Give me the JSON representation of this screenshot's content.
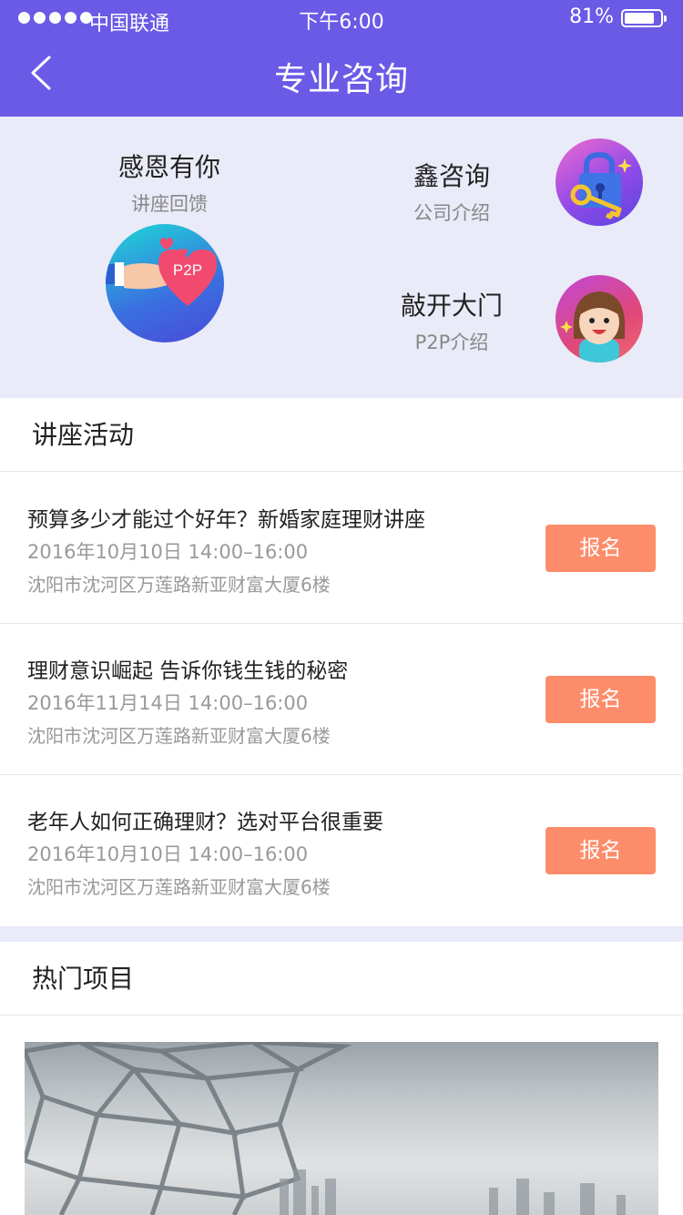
{
  "status_bar": {
    "carrier": "中国联通",
    "time": "下午6:00",
    "battery": "81%"
  },
  "nav": {
    "title": "专业咨询"
  },
  "tiles": {
    "left": {
      "title": "感恩有你",
      "subtitle": "讲座回馈",
      "badge": "P2P"
    },
    "right_top": {
      "title": "鑫咨询",
      "subtitle": "公司介绍"
    },
    "right_bottom": {
      "title": "敲开大门",
      "subtitle": "P2P介绍"
    }
  },
  "lectures": {
    "header": "讲座活动",
    "items": [
      {
        "title": "预算多少才能过个好年？新婚家庭理财讲座",
        "date": "2016年10月10日 14:00–16:00",
        "address": "沈阳市沈河区万莲路新亚财富大厦6楼",
        "button": "报名"
      },
      {
        "title": "理财意识崛起 告诉你钱生钱的秘密",
        "date": "2016年11月14日 14:00–16:00",
        "address": "沈阳市沈河区万莲路新亚财富大厦6楼",
        "button": "报名"
      },
      {
        "title": "老年人如何正确理财？选对平台很重要",
        "date": "2016年10月10日 14:00–16:00",
        "address": "沈阳市沈河区万莲路新亚财富大厦6楼",
        "button": "报名"
      }
    ]
  },
  "hot": {
    "header": "热门项目"
  },
  "colors": {
    "brand": "#6a5ae6",
    "accent": "#fd8c6a",
    "background": "#eaebf8"
  },
  "icons": [
    "back-icon",
    "heart-hand-icon",
    "lock-key-icon",
    "girl-avatar-icon"
  ]
}
